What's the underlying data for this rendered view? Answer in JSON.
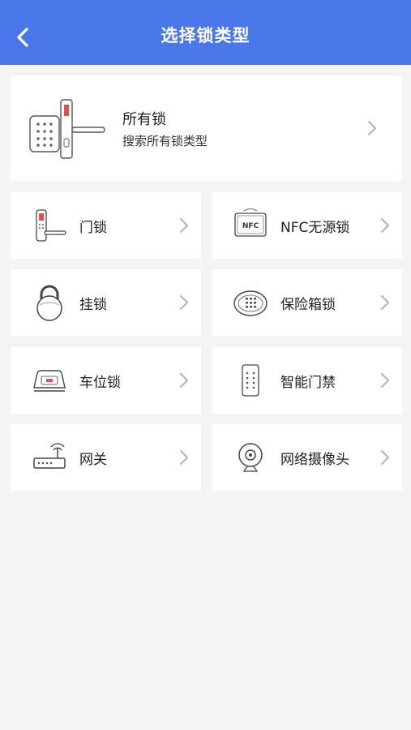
{
  "header": {
    "title": "选择锁类型",
    "back_icon": "chevron-left-icon"
  },
  "all_locks": {
    "title": "所有锁",
    "subtitle": "搜索所有锁类型",
    "icon": "door-lock-keypad-icon"
  },
  "categories": [
    {
      "label": "门锁",
      "icon": "door-lock-icon"
    },
    {
      "label": "NFC无源锁",
      "icon": "nfc-icon"
    },
    {
      "label": "挂锁",
      "icon": "padlock-icon"
    },
    {
      "label": "保险箱锁",
      "icon": "safe-icon"
    },
    {
      "label": "车位锁",
      "icon": "parking-lock-icon"
    },
    {
      "label": "智能门禁",
      "icon": "access-control-icon"
    },
    {
      "label": "网关",
      "icon": "gateway-router-icon"
    },
    {
      "label": "网络摄像头",
      "icon": "camera-icon"
    }
  ],
  "colors": {
    "header_bg": "#4a78ea",
    "page_bg": "#f4f4f4",
    "card_bg": "#ffffff",
    "chevron": "#b3b3b3"
  }
}
